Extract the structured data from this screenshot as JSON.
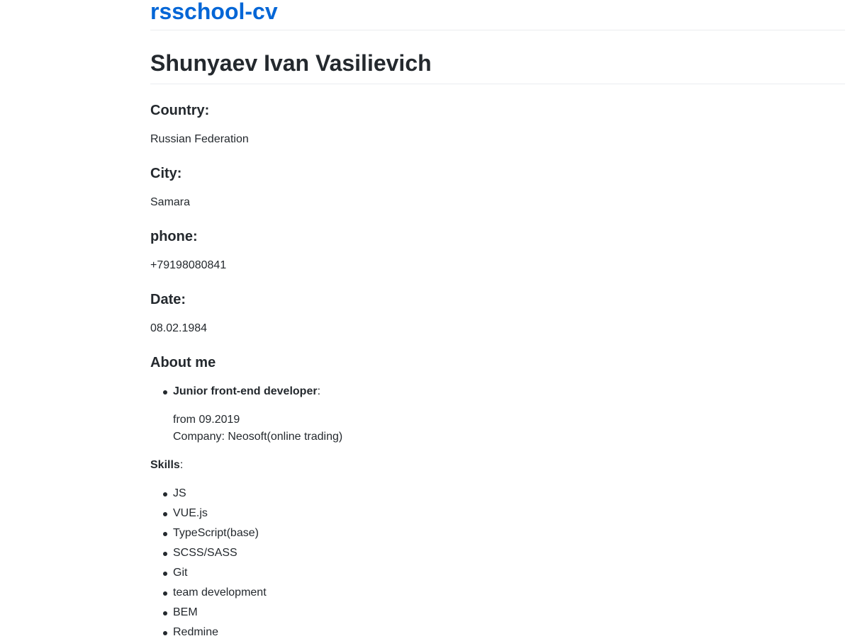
{
  "header": {
    "site_title": "rsschool-cv"
  },
  "profile": {
    "name": "Shunyaev Ivan Vasilievich",
    "country_label": "Country:",
    "country": "Russian Federation",
    "city_label": "City:",
    "city": "Samara",
    "phone_label": "phone:",
    "phone": "+79198080841",
    "date_label": "Date:",
    "date": "08.02.1984"
  },
  "about": {
    "heading": "About me",
    "role": "Junior front-end developer",
    "role_suffix": ":",
    "since": "from 09.2019",
    "company": "Company: Neosoft(online trading)"
  },
  "skills": {
    "label": "Skills",
    "label_suffix": ":",
    "items": [
      "JS",
      "VUE.js",
      "TypeScript(base)",
      "SCSS/SASS",
      "Git",
      "team development",
      "BEM",
      "Redmine"
    ]
  }
}
